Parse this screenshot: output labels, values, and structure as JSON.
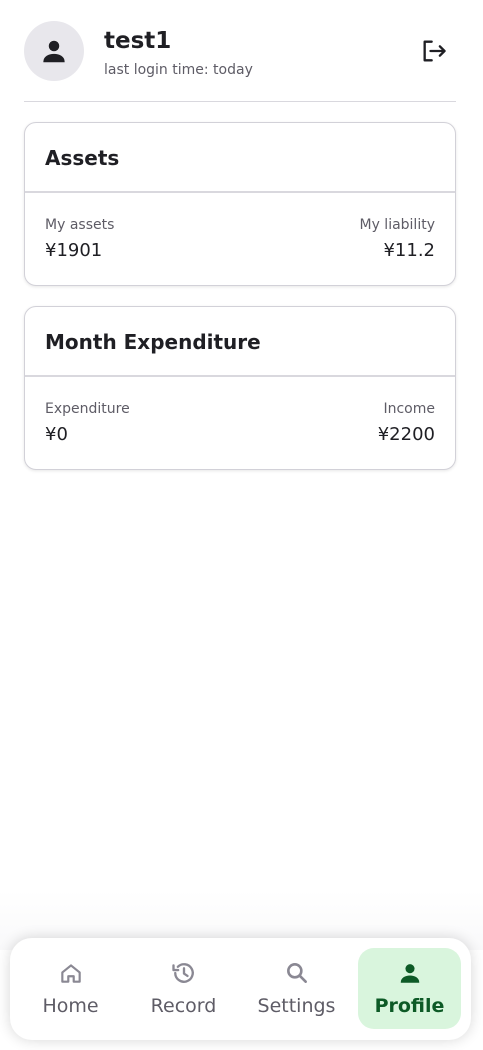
{
  "user": {
    "name": "test1",
    "last_login": "last login time: today"
  },
  "icons": {
    "avatar": "person-icon",
    "logout": "logout-icon"
  },
  "assets_card": {
    "title": "Assets",
    "left_label": "My assets",
    "left_value": "¥1901",
    "right_label": "My liability",
    "right_value": "¥11.2"
  },
  "month_card": {
    "title": "Month Expenditure",
    "left_label": "Expenditure",
    "left_value": "¥0",
    "right_label": "Income",
    "right_value": "¥2200"
  },
  "nav": {
    "items": [
      {
        "label": "Home",
        "icon": "home-icon",
        "active": false
      },
      {
        "label": "Record",
        "icon": "history-icon",
        "active": false
      },
      {
        "label": "Settings",
        "icon": "search-icon",
        "active": false
      },
      {
        "label": "Profile",
        "icon": "person-icon",
        "active": true
      }
    ]
  },
  "colors": {
    "active_bg": "#d9f5dd",
    "active_fg": "#0d5a26",
    "inactive_fg": "#5e5c66"
  }
}
